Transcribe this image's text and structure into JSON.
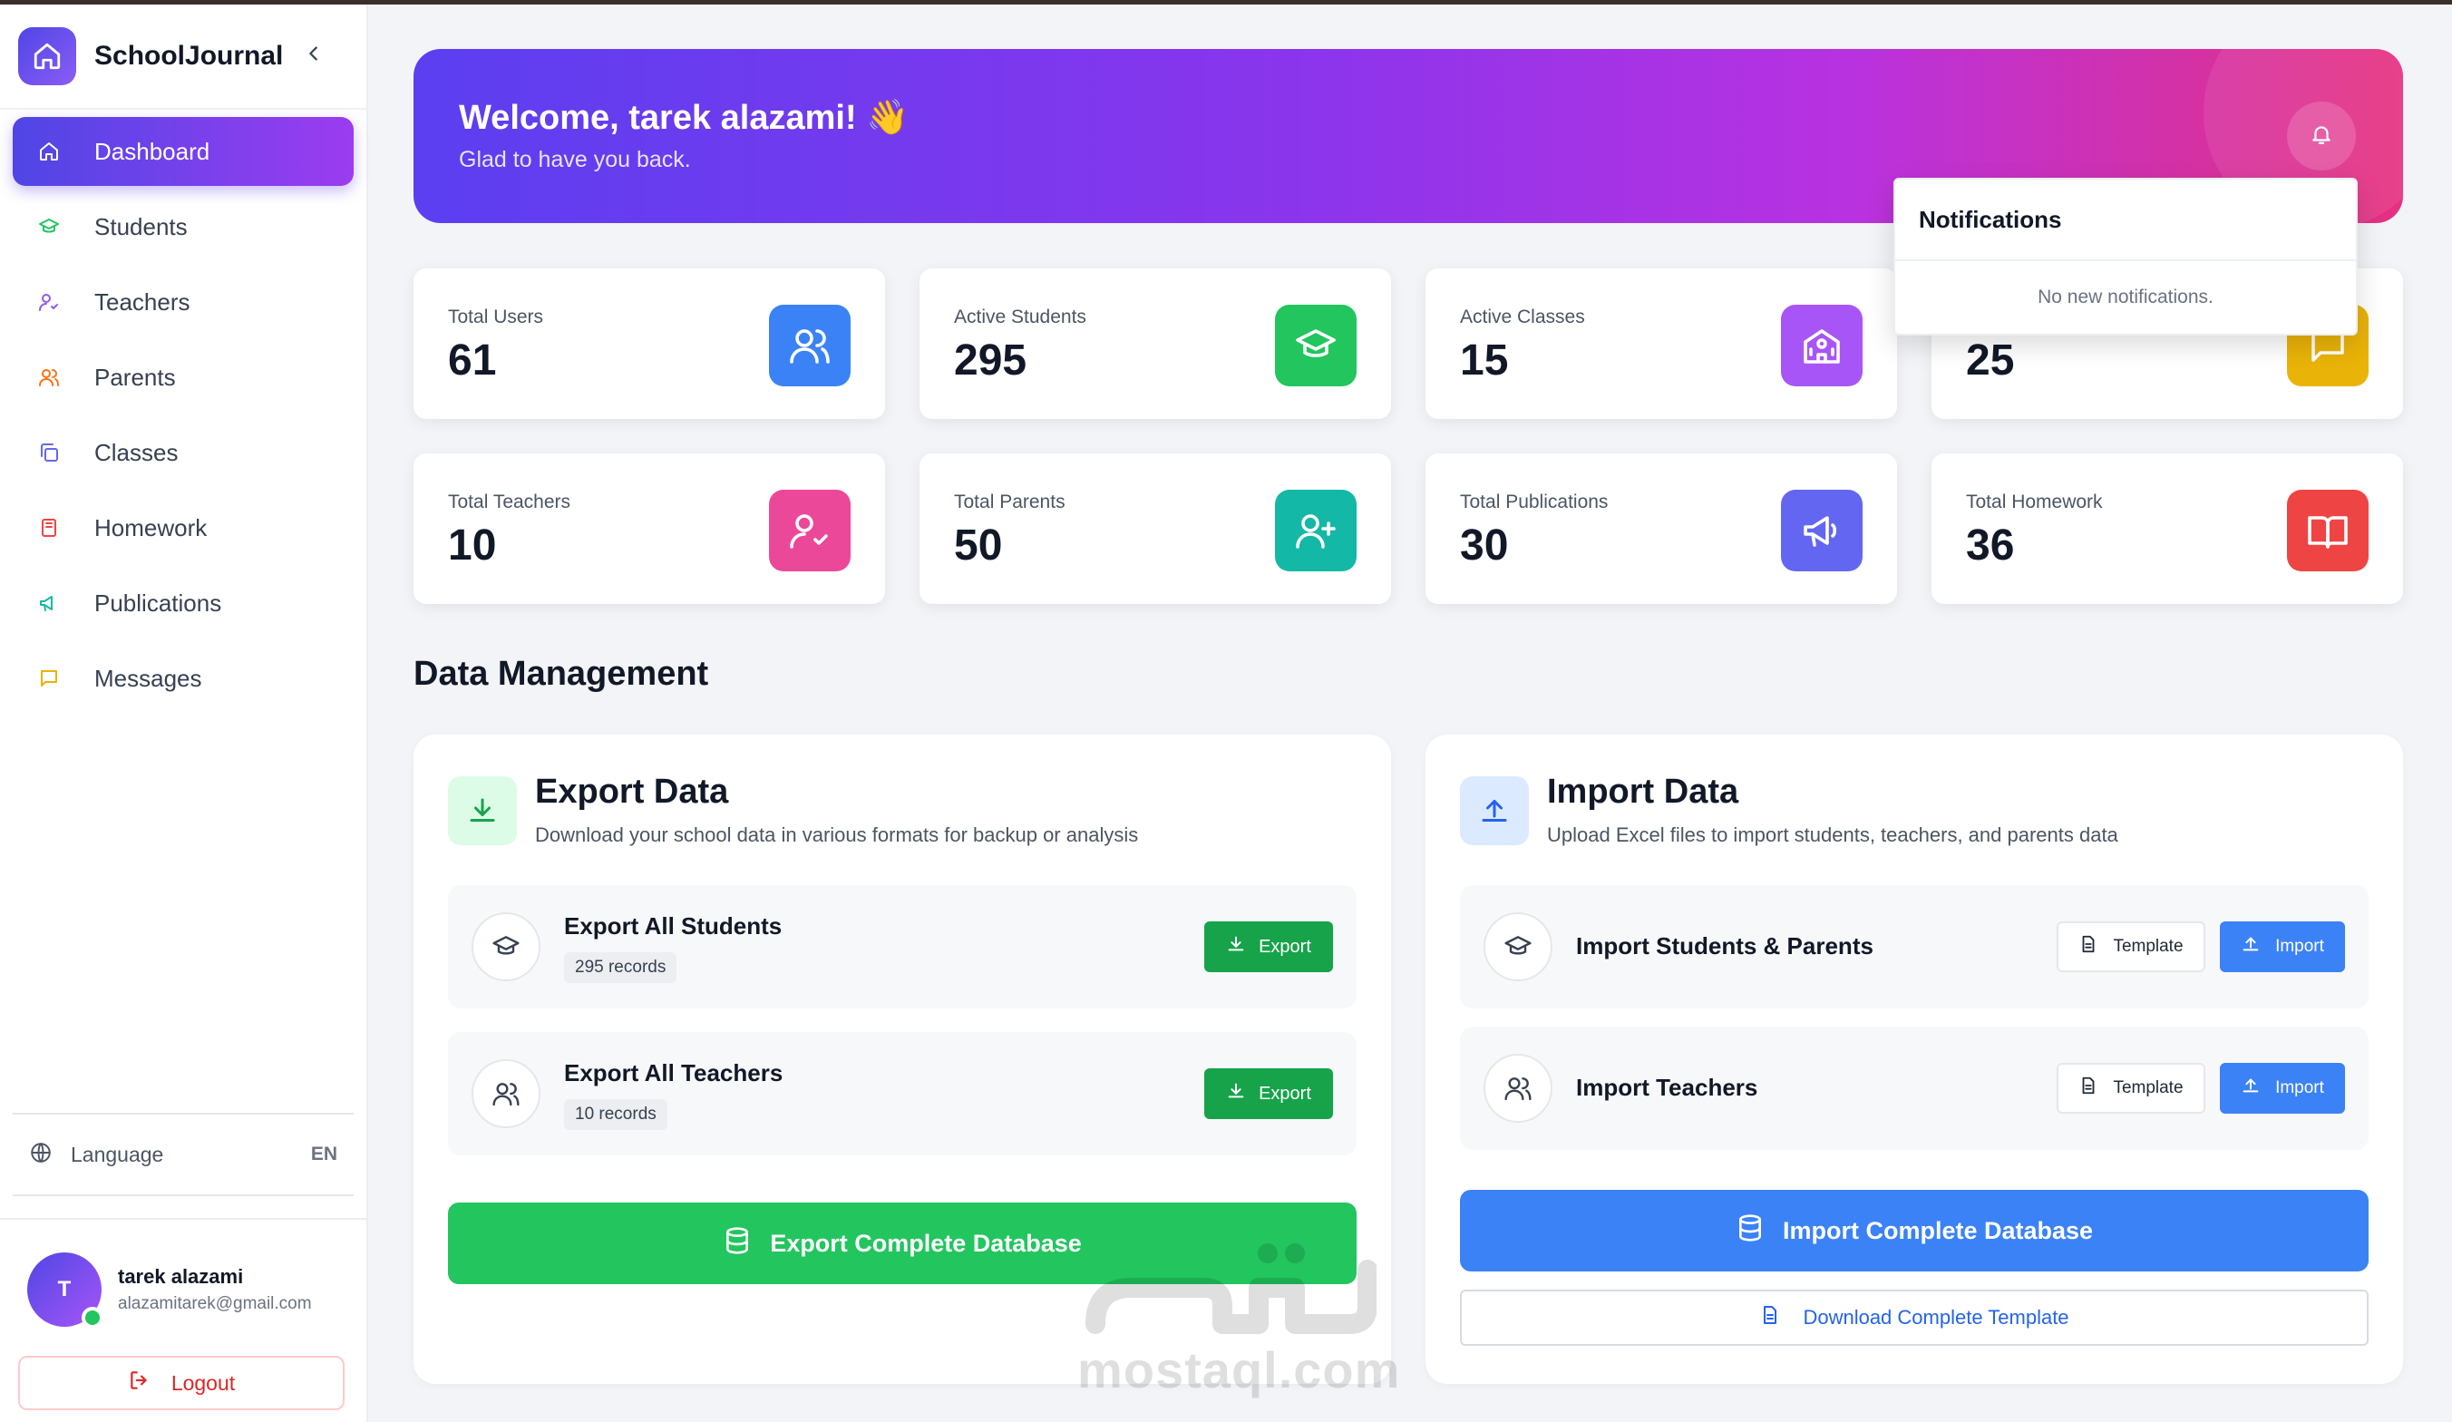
{
  "brand": {
    "name": "SchoolJournal"
  },
  "nav": [
    {
      "label": "Dashboard",
      "icon": "home-icon",
      "active": true
    },
    {
      "label": "Students",
      "icon": "graduation-cap-icon",
      "color": "#22c55e"
    },
    {
      "label": "Teachers",
      "icon": "user-check-icon",
      "color": "#8b5cf6"
    },
    {
      "label": "Parents",
      "icon": "users-icon",
      "color": "#f97316"
    },
    {
      "label": "Classes",
      "icon": "copy-icon",
      "color": "#6366f1"
    },
    {
      "label": "Homework",
      "icon": "book-icon",
      "color": "#ef4444"
    },
    {
      "label": "Publications",
      "icon": "megaphone-icon",
      "color": "#14b8a6"
    },
    {
      "label": "Messages",
      "icon": "message-icon",
      "color": "#eab308"
    }
  ],
  "language": {
    "label": "Language",
    "value": "EN"
  },
  "user": {
    "initial": "T",
    "name": "tarek alazami",
    "email": "alazamitarek@gmail.com"
  },
  "logout_label": "Logout",
  "hero": {
    "title": "Welcome, tarek alazami! 👋",
    "subtitle": "Glad to have you back."
  },
  "notifications": {
    "title": "Notifications",
    "empty": "No new notifications."
  },
  "stats": [
    {
      "label": "Total Users",
      "value": "61",
      "color": "#3b82f6",
      "icon": "users-icon"
    },
    {
      "label": "Active Students",
      "value": "295",
      "color": "#22c55e",
      "icon": "graduation-cap-icon"
    },
    {
      "label": "Active Classes",
      "value": "15",
      "color": "#a855f7",
      "icon": "school-icon"
    },
    {
      "label": "",
      "value": "25",
      "color": "#eab308",
      "icon": "message-icon"
    },
    {
      "label": "Total Teachers",
      "value": "10",
      "color": "#ec4899",
      "icon": "user-check-icon"
    },
    {
      "label": "Total Parents",
      "value": "50",
      "color": "#14b8a6",
      "icon": "user-plus-icon"
    },
    {
      "label": "Total Publications",
      "value": "30",
      "color": "#6366f1",
      "icon": "megaphone-icon"
    },
    {
      "label": "Total Homework",
      "value": "36",
      "color": "#ef4444",
      "icon": "book-open-icon"
    }
  ],
  "section_title": "Data Management",
  "export": {
    "title": "Export Data",
    "description": "Download your school data in various formats for backup or analysis",
    "rows": [
      {
        "title": "Export All Students",
        "badge": "295 records",
        "button": "Export"
      },
      {
        "title": "Export All Teachers",
        "badge": "10 records",
        "button": "Export"
      }
    ],
    "complete_button": "Export Complete Database"
  },
  "import": {
    "title": "Import Data",
    "description": "Upload Excel files to import students, teachers, and parents data",
    "rows": [
      {
        "title": "Import Students & Parents",
        "template": "Template",
        "import": "Import"
      },
      {
        "title": "Import Teachers",
        "template": "Template",
        "import": "Import"
      }
    ],
    "complete_button": "Import Complete Database",
    "download_template": "Download Complete Template"
  },
  "watermark": {
    "text": "mostaql.com"
  }
}
